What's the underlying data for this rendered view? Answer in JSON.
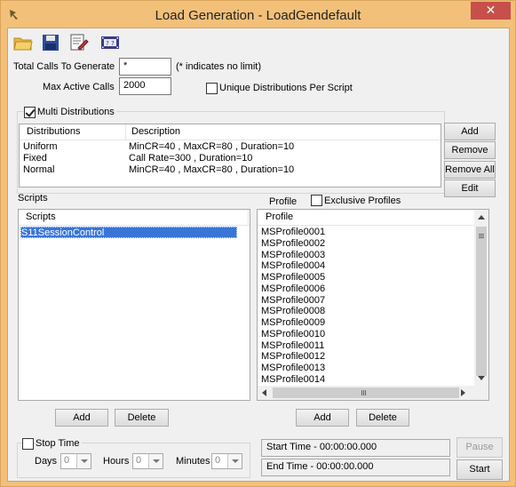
{
  "window": {
    "title": "Load Generation - LoadGendefault",
    "close_label": "✕"
  },
  "toolbar": {
    "icons": [
      "open-folder-icon",
      "save-icon",
      "edit-document-icon",
      "help-film-icon"
    ]
  },
  "settings": {
    "total_calls_label": "Total Calls To Generate",
    "total_calls_value": "*",
    "total_calls_hint": "(* indicates no limit)",
    "max_active_label": "Max Active Calls",
    "max_active_value": "2000",
    "unique_dist_label": "Unique Distributions Per Script",
    "unique_dist_checked": false,
    "multi_dist_label": "Multi Distributions",
    "multi_dist_checked": true
  },
  "distributions": {
    "columns": [
      "Distributions",
      "Description"
    ],
    "rows": [
      {
        "name": "Uniform",
        "description": "MinCR=40 , MaxCR=80 , Duration=10"
      },
      {
        "name": "Fixed",
        "description": "Call Rate=300 , Duration=10"
      },
      {
        "name": "Normal",
        "description": "MinCR=40 , MaxCR=80 , Duration=10"
      }
    ],
    "buttons": {
      "add": "Add",
      "remove": "Remove",
      "remove_all": "Remove All",
      "edit": "Edit"
    }
  },
  "scripts": {
    "group_label": "Scripts",
    "column": "Scripts",
    "items": [
      "S11SessionControl"
    ],
    "selected_index": 0,
    "add_label": "Add",
    "delete_label": "Delete"
  },
  "profiles": {
    "group_label": "Profile",
    "exclusive_label": "Exclusive Profiles",
    "exclusive_checked": false,
    "column": "Profile",
    "items": [
      "MSProfile0001",
      "MSProfile0002",
      "MSProfile0003",
      "MSProfile0004",
      "MSProfile0005",
      "MSProfile0006",
      "MSProfile0007",
      "MSProfile0008",
      "MSProfile0009",
      "MSProfile0010",
      "MSProfile0011",
      "MSProfile0012",
      "MSProfile0013",
      "MSProfile0014"
    ],
    "add_label": "Add",
    "delete_label": "Delete"
  },
  "stop_time": {
    "label": "Stop Time",
    "checked": false,
    "days_label": "Days",
    "days_value": "0",
    "hours_label": "Hours",
    "hours_value": "0",
    "minutes_label": "Minutes",
    "minutes_value": "0"
  },
  "run": {
    "start_time_text": "Start Time - 00:00:00.000",
    "end_time_text": "End Time  - 00:00:00.000",
    "pause_label": "Pause",
    "start_label": "Start"
  },
  "colors": {
    "titlebar": "#f3c079",
    "selection": "#3875d7",
    "close": "#c7504a"
  }
}
